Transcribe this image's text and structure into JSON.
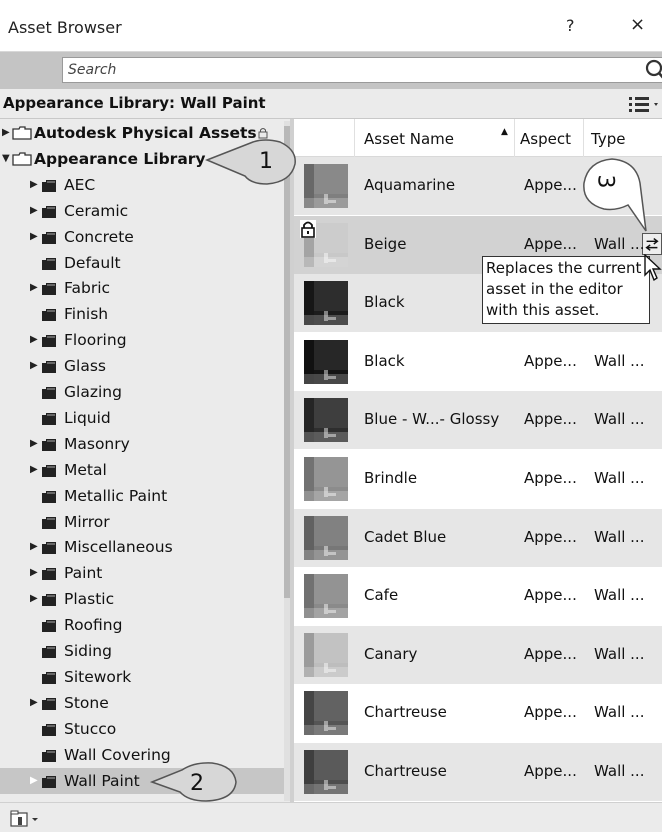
{
  "window": {
    "title": "Asset Browser",
    "help": "?",
    "close": "×"
  },
  "search": {
    "placeholder": "Search"
  },
  "library_header": {
    "title": "Appearance Library: Wall Paint"
  },
  "tree": {
    "items": [
      {
        "label": "Autodesk Physical Assets",
        "level": 0,
        "arrow": "right",
        "bold": true
      },
      {
        "label": "Appearance Library",
        "level": 0,
        "arrow": "down",
        "bold": true
      },
      {
        "label": "AEC",
        "level": 1,
        "arrow": "right"
      },
      {
        "label": "Ceramic",
        "level": 1,
        "arrow": "right"
      },
      {
        "label": "Concrete",
        "level": 1,
        "arrow": "right"
      },
      {
        "label": "Default",
        "level": 1,
        "arrow": "none"
      },
      {
        "label": "Fabric",
        "level": 1,
        "arrow": "right"
      },
      {
        "label": "Finish",
        "level": 1,
        "arrow": "none"
      },
      {
        "label": "Flooring",
        "level": 1,
        "arrow": "right"
      },
      {
        "label": "Glass",
        "level": 1,
        "arrow": "right"
      },
      {
        "label": "Glazing",
        "level": 1,
        "arrow": "none"
      },
      {
        "label": "Liquid",
        "level": 1,
        "arrow": "none"
      },
      {
        "label": "Masonry",
        "level": 1,
        "arrow": "right"
      },
      {
        "label": "Metal",
        "level": 1,
        "arrow": "right"
      },
      {
        "label": "Metallic Paint",
        "level": 1,
        "arrow": "none"
      },
      {
        "label": "Mirror",
        "level": 1,
        "arrow": "none"
      },
      {
        "label": "Miscellaneous",
        "level": 1,
        "arrow": "right"
      },
      {
        "label": "Paint",
        "level": 1,
        "arrow": "right"
      },
      {
        "label": "Plastic",
        "level": 1,
        "arrow": "right"
      },
      {
        "label": "Roofing",
        "level": 1,
        "arrow": "none"
      },
      {
        "label": "Siding",
        "level": 1,
        "arrow": "none"
      },
      {
        "label": "Sitework",
        "level": 1,
        "arrow": "none"
      },
      {
        "label": "Stone",
        "level": 1,
        "arrow": "right"
      },
      {
        "label": "Stucco",
        "level": 1,
        "arrow": "none"
      },
      {
        "label": "Wall Covering",
        "level": 1,
        "arrow": "none"
      },
      {
        "label": "Wall Paint",
        "level": 1,
        "arrow": "right-light",
        "selected": true
      }
    ]
  },
  "grid": {
    "headers": {
      "name": "Asset Name",
      "aspect": "Aspect",
      "type": "Type"
    },
    "rows": [
      {
        "name": "Aquamarine",
        "aspect": "Appe...",
        "type": "",
        "thumb_color": "#7f7f7f"
      },
      {
        "name": "Beige",
        "aspect": "Appe...",
        "type": "Wall ...",
        "thumb_color": "#c8c8c8",
        "locked": true
      },
      {
        "name": "Black",
        "aspect": "",
        "type": "",
        "thumb_color": "#1c1c1c"
      },
      {
        "name": "Black",
        "aspect": "Appe...",
        "type": "Wall ...",
        "thumb_color": "#151515"
      },
      {
        "name": "Blue - W...- Glossy",
        "aspect": "Appe...",
        "type": "Wall ...",
        "thumb_color": "#2e2e2e"
      },
      {
        "name": "Brindle",
        "aspect": "Appe...",
        "type": "Wall ...",
        "thumb_color": "#8c8c8c"
      },
      {
        "name": "Cadet Blue",
        "aspect": "Appe...",
        "type": "Wall ...",
        "thumb_color": "#777777"
      },
      {
        "name": "Cafe",
        "aspect": "Appe...",
        "type": "Wall ...",
        "thumb_color": "#8a8a8a"
      },
      {
        "name": "Canary",
        "aspect": "Appe...",
        "type": "Wall ...",
        "thumb_color": "#bdbdbd"
      },
      {
        "name": "Chartreuse",
        "aspect": "Appe...",
        "type": "Wall ...",
        "thumb_color": "#555555"
      },
      {
        "name": "Chartreuse",
        "aspect": "Appe...",
        "type": "Wall ...",
        "thumb_color": "#4d4d4d"
      }
    ]
  },
  "tooltip": {
    "line1": "Replaces the current",
    "line2": "asset in the editor",
    "line3": "with this asset."
  },
  "callouts": {
    "one": "1",
    "two": "2",
    "three": "3"
  }
}
